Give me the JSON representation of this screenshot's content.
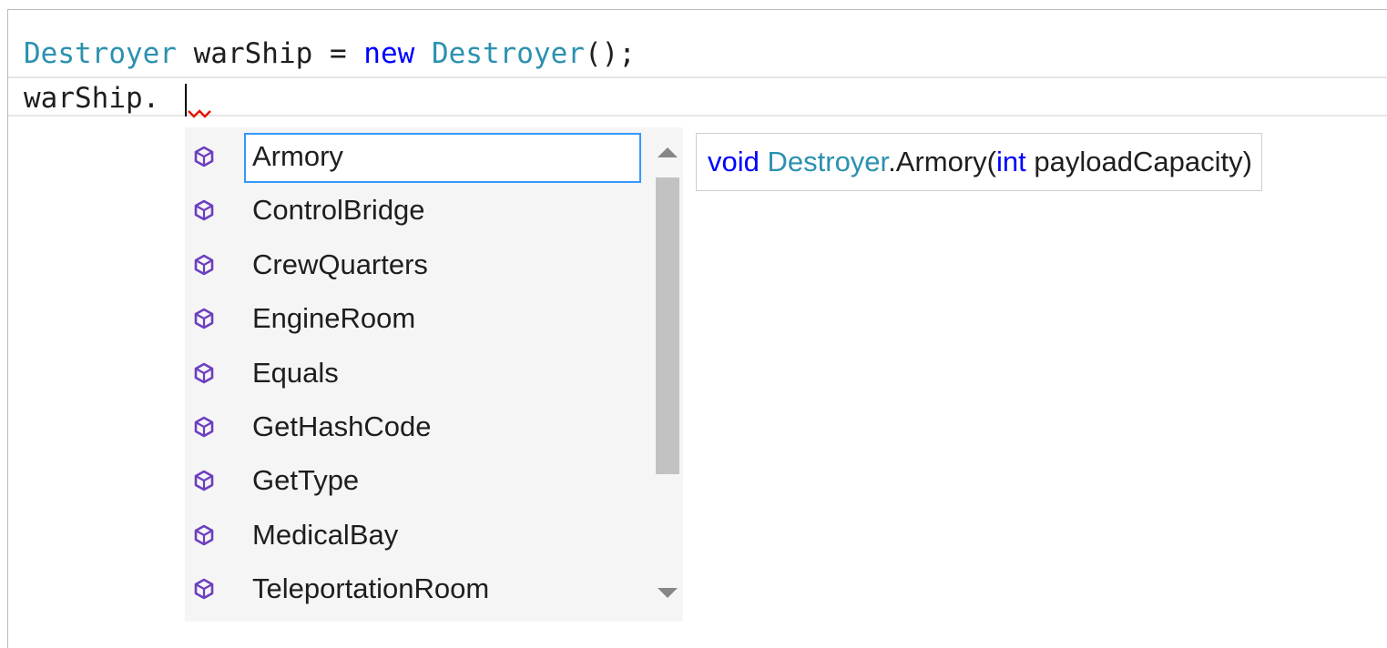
{
  "editor": {
    "line1": {
      "type": "Destroyer",
      "var": " warShip = ",
      "kw": "new",
      "space": " ",
      "ctor": "Destroyer",
      "tail": "();"
    },
    "line2": {
      "text": "warShip."
    }
  },
  "completion": {
    "icon": "method-cube-icon",
    "icon_color": "#6c3fbf",
    "items": [
      "Armory",
      "ControlBridge",
      "CrewQuarters",
      "EngineRoom",
      "Equals",
      "GetHashCode",
      "GetType",
      "MedicalBay",
      "TeleportationRoom"
    ],
    "selected": "Armory"
  },
  "tooltip": {
    "return_type": "void",
    "space1": " ",
    "class": "Destroyer",
    "member": ".Armory(",
    "param_type": "int",
    "param": " payloadCapacity)"
  },
  "colors": {
    "type": "#2b91af",
    "keyword": "#0000ff",
    "selection_border": "#3399ff",
    "list_background": "#f5f5f5"
  }
}
